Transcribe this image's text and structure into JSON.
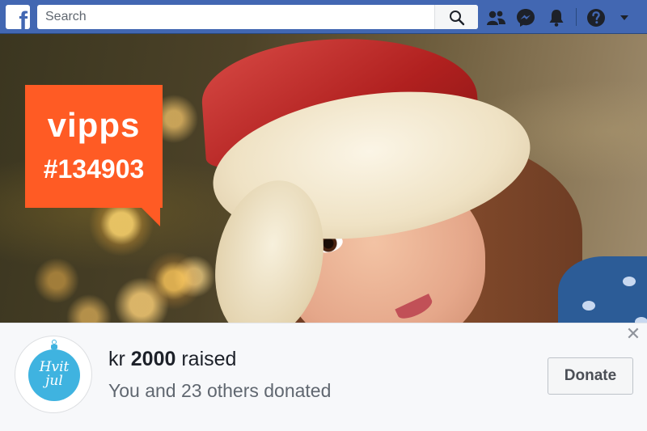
{
  "topbar": {
    "logo_letter": "f",
    "search": {
      "placeholder": "Search",
      "value": ""
    },
    "icons": [
      "friends-icon",
      "messenger-icon",
      "notifications-icon",
      "help-icon",
      "dropdown-icon"
    ],
    "colors": {
      "bar": "#4267b2",
      "icon": "#1d2129"
    }
  },
  "hero": {
    "badge": {
      "brand": "vipps",
      "code": "#134903",
      "color": "#ff5b24"
    }
  },
  "fundraiser": {
    "avatar_text_line1": "Hvit",
    "avatar_text_line2": "jul",
    "raised_prefix": "kr ",
    "raised_amount": "2000",
    "raised_suffix": " raised",
    "donors_text": "You and 23 others donated",
    "donate_label": "Donate",
    "close_label": "✕"
  }
}
